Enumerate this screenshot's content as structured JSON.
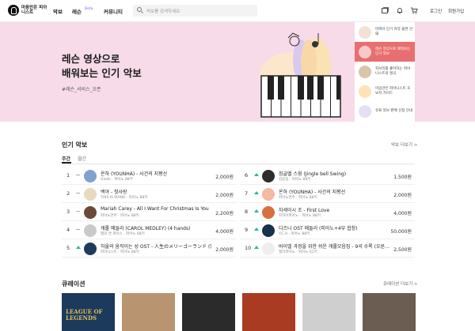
{
  "header": {
    "logo_text": "마음만은 피아니스트",
    "nav": [
      "악보",
      "레슨",
      "커뮤니티"
    ],
    "beta": "Beta",
    "search_placeholder": "악보를 검색하세요",
    "login": "로그인",
    "signup": "회원가입"
  },
  "banner": {
    "title_line1": "레슨 영상으로",
    "title_line2": "배워보는 인기 악보",
    "tag": "#레슨_서비스_오픈",
    "side_items": [
      {
        "label": "마피아 인기 커뮤 물연 안 돼",
        "color": "#f2e2d5"
      },
      {
        "label": "레슨 영상으로 배워보는 인기 악보",
        "color": "#f7c9c9"
      },
      {
        "label": "지브리를 좋아하는 피아니스트의 명곡",
        "color": "#d7c6a8"
      },
      {
        "label": "마음만은 피아니스트 초보자 가이드",
        "color": "#ffe2b8"
      },
      {
        "label": "유료 악보 판매 신청 안내",
        "color": "#e6def5"
      }
    ]
  },
  "popular": {
    "title": "인기 악보",
    "more": "악보 더보기 >",
    "tabs": [
      "주간",
      "월간"
    ],
    "rows_left": [
      {
        "rank": "1",
        "trend": "flat",
        "title": "온하 (YOUNHA) - 사건의 지평선",
        "sub": "Gielle · 피아노 88키",
        "price": "2,000원",
        "thumb": "#7fa3d1"
      },
      {
        "rank": "2",
        "trend": "flat",
        "title": "백야 - 첫사랑",
        "sub": "THIS IS PIANO · 피아노 88키",
        "price": "2,000원",
        "thumb": "#e8d9bf"
      },
      {
        "rank": "3",
        "trend": "flat",
        "title": "Mariah Carey - All I Want For Christmas Is You",
        "sub": "피아노연주 · 피아노 88키",
        "price": "2,200원",
        "thumb": "#6b4a3a"
      },
      {
        "rank": "4",
        "trend": "flat",
        "title": "캐롤 메들리 (CAROL MEDLEY) (4 hands)",
        "sub": "별의 연 피아스 · 피아노 88키",
        "price": "4,000원",
        "thumb": "#c9c9c9"
      },
      {
        "rank": "5",
        "trend": "up",
        "title": "하울의 움직이는 성 OST - 人生のメリーゴーランド (인생…",
        "sub": "피아니스트 · 피아노 88키",
        "price": "2,000원",
        "thumb": "#1f3b5c"
      }
    ],
    "rows_right": [
      {
        "rank": "6",
        "trend": "up",
        "title": "징글벨 스윙 (Jingle bell Swing)",
        "sub": "김윤섭 · 피아노 88키",
        "price": "1,500원",
        "thumb": "#2d2d2d"
      },
      {
        "rank": "7",
        "trend": "up",
        "title": "온하 (YOUNHA) - 사건의 지평선",
        "sub": "피아노연주 · 피아노 88키",
        "price": "2,000원",
        "thumb": "#f5b8a0"
      },
      {
        "rank": "8",
        "trend": "up",
        "title": "차세이시 조 - First Love",
        "sub": "지지아피아노 · 피아노 88키",
        "price": "4,000원",
        "thumb": "#d96f3e"
      },
      {
        "rank": "9",
        "trend": "up",
        "title": "디즈니 OST 메들리 (피아노+4부 합창)",
        "sub": "Y.C.H · 피아노 88키",
        "price": "50,000원",
        "thumb": "#17324f"
      },
      {
        "rank": "10",
        "trend": "up",
        "title": "바이엘 과정을 위한 쉬운 캐롤모음집 - 9곡 수록 (오른…",
        "sub": "엘리피아노 · 피아노 61키",
        "price": "2,500원",
        "thumb": "#eeeeee"
      }
    ]
  },
  "curation": {
    "title": "큐레이션",
    "more": "큐레이션 더보기 >",
    "items": [
      {
        "name": "League of Legends",
        "label": "LEAGUE OF LEGENDS",
        "color": "#1b3a5c"
      },
      {
        "name": "Piano hands",
        "label": "",
        "color": "#b89470"
      },
      {
        "name": "Pianist",
        "label": "",
        "color": "#2b2b2b"
      },
      {
        "name": "Home Alone",
        "label": "",
        "color": "#a83b22"
      },
      {
        "name": "Portrait",
        "label": "",
        "color": "#cfcfcf"
      },
      {
        "name": "Grand piano",
        "label": "",
        "color": "#6b5d52"
      }
    ]
  }
}
